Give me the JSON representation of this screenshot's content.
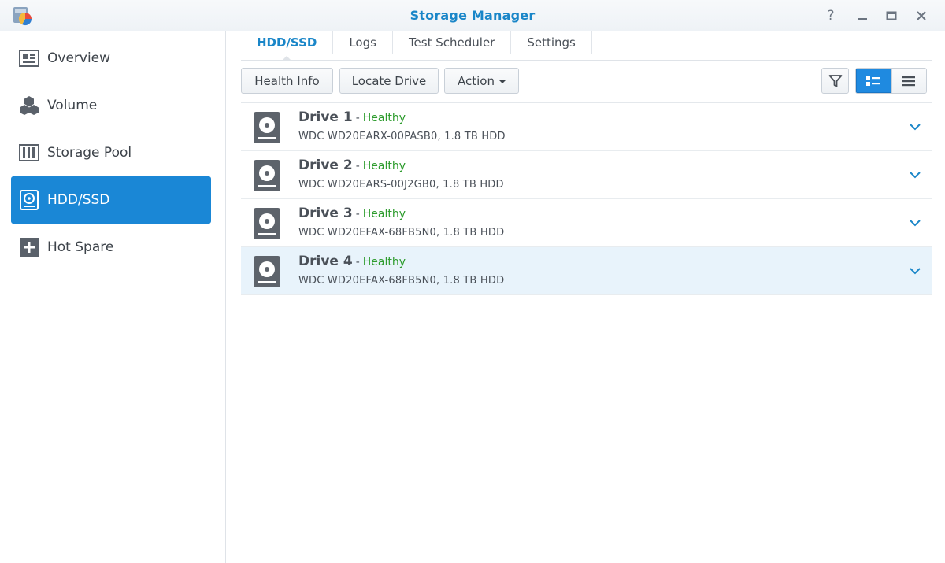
{
  "window": {
    "title": "Storage Manager",
    "help_label": "?"
  },
  "sidebar": {
    "items": [
      {
        "label": "Overview",
        "icon": "overview-icon",
        "active": false
      },
      {
        "label": "Volume",
        "icon": "volume-icon",
        "active": false
      },
      {
        "label": "Storage Pool",
        "icon": "storage-pool-icon",
        "active": false
      },
      {
        "label": "HDD/SSD",
        "icon": "hdd-icon",
        "active": true
      },
      {
        "label": "Hot Spare",
        "icon": "hot-spare-icon",
        "active": false
      }
    ]
  },
  "tabs": [
    {
      "label": "HDD/SSD",
      "active": true
    },
    {
      "label": "Logs",
      "active": false
    },
    {
      "label": "Test Scheduler",
      "active": false
    },
    {
      "label": "Settings",
      "active": false
    }
  ],
  "toolbar": {
    "health_info_label": "Health Info",
    "locate_drive_label": "Locate Drive",
    "action_label": "Action"
  },
  "drives": [
    {
      "name": "Drive 1",
      "separator": "-",
      "status": "Healthy",
      "model": "WDC WD20EARX-00PASB0, 1.8 TB HDD",
      "selected": false
    },
    {
      "name": "Drive 2",
      "separator": "-",
      "status": "Healthy",
      "model": "WDC WD20EARS-00J2GB0, 1.8 TB HDD",
      "selected": false
    },
    {
      "name": "Drive 3",
      "separator": "-",
      "status": "Healthy",
      "model": "WDC WD20EFAX-68FB5N0, 1.8 TB HDD",
      "selected": false
    },
    {
      "name": "Drive 4",
      "separator": "-",
      "status": "Healthy",
      "model": "WDC WD20EFAX-68FB5N0, 1.8 TB HDD",
      "selected": true
    }
  ],
  "colors": {
    "accent": "#1a87d6",
    "title": "#1a86c8",
    "healthy": "#2e9c2e",
    "selected_row": "#e8f3fb"
  }
}
